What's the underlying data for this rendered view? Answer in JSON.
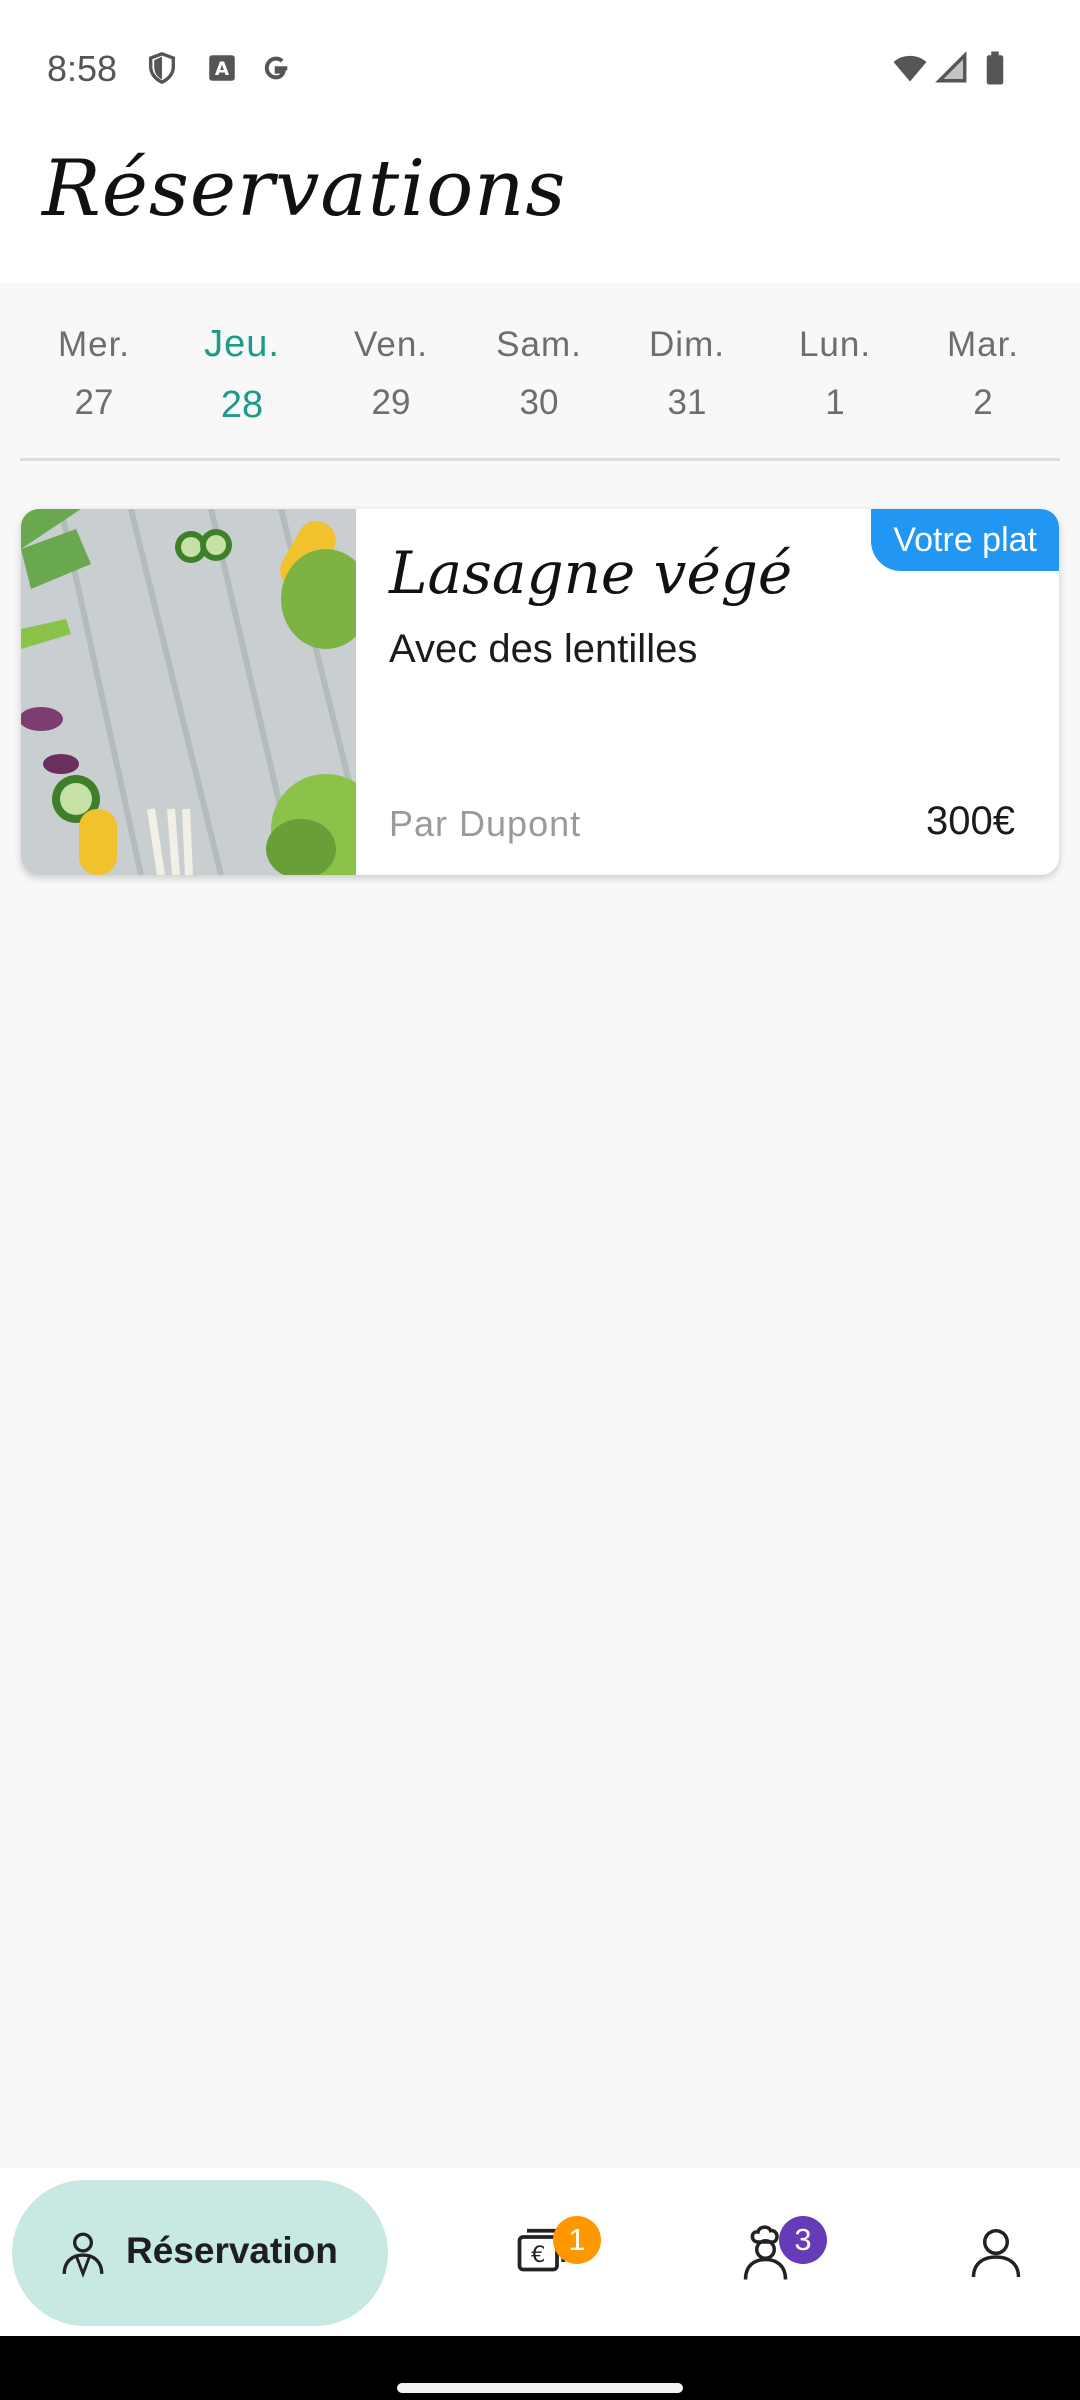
{
  "status_bar": {
    "time": "8:58",
    "left_icons": [
      "shield-icon",
      "text-a-icon",
      "google-g-icon"
    ],
    "right_icons": [
      "wifi-icon",
      "signal-icon",
      "battery-icon"
    ]
  },
  "header": {
    "title": "Réservations"
  },
  "days": [
    {
      "name": "Mer.",
      "num": "27"
    },
    {
      "name": "Jeu.",
      "num": "28",
      "selected": true
    },
    {
      "name": "Ven.",
      "num": "29"
    },
    {
      "name": "Sam.",
      "num": "30"
    },
    {
      "name": "Dim.",
      "num": "31"
    },
    {
      "name": "Lun.",
      "num": "1"
    },
    {
      "name": "Mar.",
      "num": "2"
    }
  ],
  "card": {
    "badge": "Votre plat",
    "dish_name": "Lasagne végé",
    "subtitle": "Avec des lentilles",
    "chef": "Par Dupont",
    "price": "300€"
  },
  "nav": {
    "active_label": "Réservation",
    "payments_badge": "1",
    "chef_badge": "3"
  },
  "colors": {
    "accent": "#1d9a8a",
    "badge_blue": "#2196f3",
    "nav_active_bg": "#c8e8e3",
    "badge_orange": "#ff9800",
    "badge_purple": "#673ab7"
  }
}
